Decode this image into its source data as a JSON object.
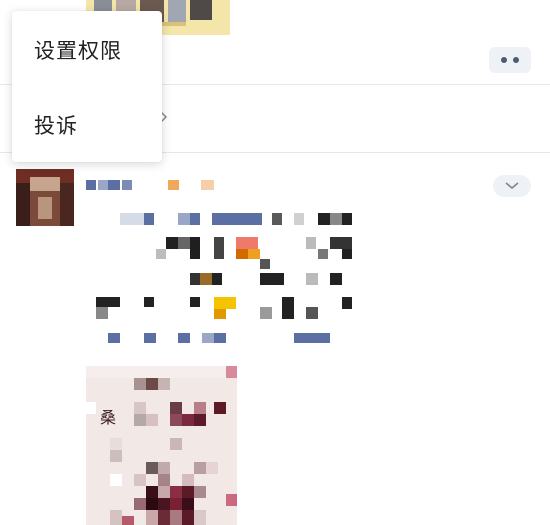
{
  "menu": {
    "items": [
      {
        "label": "设置权限"
      },
      {
        "label": "投诉"
      }
    ]
  },
  "post_image": {
    "text": "桑"
  },
  "icons": {
    "more": "more-dots-icon",
    "collapse": "chevron-down-icon",
    "expand": "chevron-right-icon"
  },
  "colors": {
    "link_blue": "#5b6fa3",
    "pill_bg": "#eef1f6"
  }
}
